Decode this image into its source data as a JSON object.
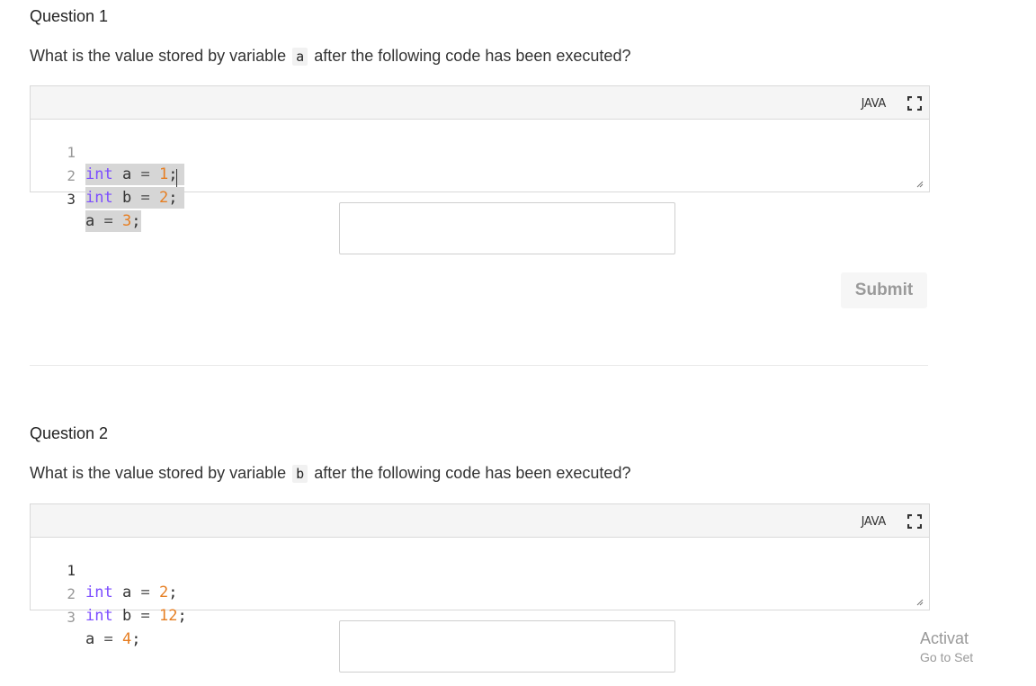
{
  "questions": [
    {
      "title": "Question 1",
      "prompt_before": "What is the value stored by variable",
      "variable": "a",
      "prompt_after": "after the following code has been executed?",
      "language": "JAVA",
      "lines": [
        {
          "num": "1",
          "kw": "int",
          "name": "a",
          "op": "=",
          "val": "1",
          "end": ";"
        },
        {
          "num": "2",
          "kw": "int",
          "name": "b",
          "op": "=",
          "val": "2",
          "end": ";"
        },
        {
          "num": "3",
          "kw": "",
          "name": "a",
          "op": "=",
          "val": "3",
          "end": ";"
        }
      ],
      "answer_value": ""
    },
    {
      "title": "Question 2",
      "prompt_before": "What is the value stored by variable",
      "variable": "b",
      "prompt_after": "after the following code has been executed?",
      "language": "JAVA",
      "lines": [
        {
          "num": "1",
          "kw": "int",
          "name": "a",
          "op": "=",
          "val": "2",
          "end": ";"
        },
        {
          "num": "2",
          "kw": "int",
          "name": "b",
          "op": "=",
          "val": "12",
          "end": ";"
        },
        {
          "num": "3",
          "kw": "",
          "name": "a",
          "op": "=",
          "val": "4",
          "end": ";"
        }
      ],
      "answer_value": ""
    }
  ],
  "submit_label": "Submit",
  "watermark": {
    "line1": "Activat",
    "line2": "Go to Set"
  },
  "icons": {
    "expand": "expand-icon",
    "resize": "resize-handle-icon"
  },
  "colors": {
    "keyword": "#7c4dff",
    "number": "#e67e22",
    "selection": "#d6d6d6"
  }
}
